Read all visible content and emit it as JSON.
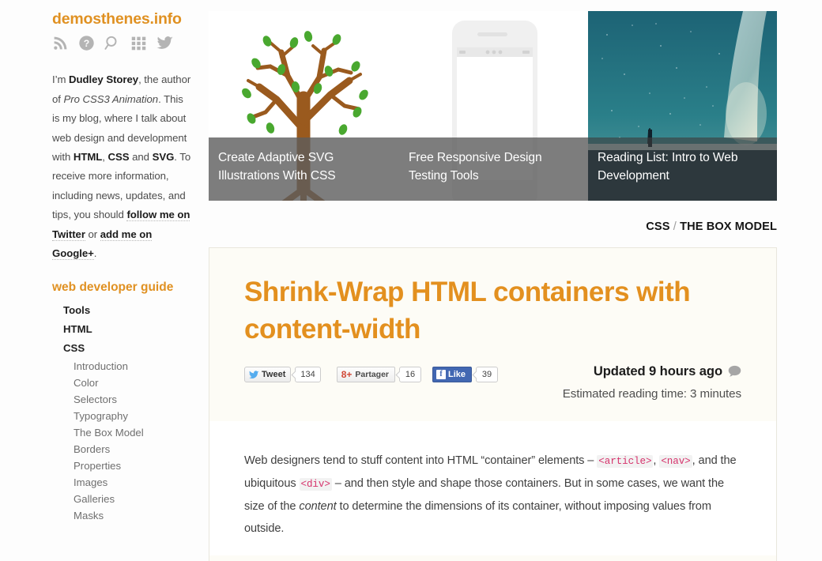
{
  "colors": {
    "accent": "#e09122",
    "title_accent": "#e3901f",
    "code_pink": "#d6336c",
    "card_bg": "#fdfcf6",
    "facebook_blue": "#4267b2",
    "gplus_red": "#d14836",
    "twitter_blue": "#55acee"
  },
  "sidebar": {
    "site_title": "demosthenes.info",
    "social_icons": [
      {
        "name": "rss-icon",
        "label": "RSS feed"
      },
      {
        "name": "help-icon",
        "label": "Help"
      },
      {
        "name": "search-icon",
        "label": "Search"
      },
      {
        "name": "grid-icon",
        "label": "All sections"
      },
      {
        "name": "twitter-icon",
        "label": "Twitter"
      }
    ],
    "bio": {
      "p1_pre": "I’m ",
      "author": "Dudley Storey",
      "p1_mid": ", the author of ",
      "book": "Pro CSS3 Animation",
      "p1_post": ". This is my blog, where I talk about web design and development with ",
      "tag_html": "HTML",
      "sep1": ", ",
      "tag_css": "CSS",
      "sep2": " and ",
      "tag_svg": "SVG",
      "p2_pre": ". To receive more information, including news, updates, and tips, you should ",
      "link_twitter": "follow me on Twitter",
      "p2_mid": " or ",
      "link_google": "add me on Google+",
      "p2_post": "."
    },
    "nav_heading": "web developer guide",
    "nav_top": [
      {
        "label": "Tools"
      },
      {
        "label": "HTML"
      },
      {
        "label": "CSS"
      }
    ],
    "nav_sub": [
      {
        "label": "Introduction"
      },
      {
        "label": "Color"
      },
      {
        "label": "Selectors"
      },
      {
        "label": "Typography"
      },
      {
        "label": "The Box Model"
      },
      {
        "label": "Borders"
      },
      {
        "label": "Properties"
      },
      {
        "label": "Images"
      },
      {
        "label": "Galleries"
      },
      {
        "label": "Masks"
      }
    ]
  },
  "featured": [
    {
      "title": "Create Adaptive SVG Illustrations With CSS",
      "image": "tree-illustration"
    },
    {
      "title": "Free Responsive Design Testing Tools",
      "image": "smartphone-illustration"
    },
    {
      "title": "Reading List: Intro to Web Development",
      "image": "milky-way-photo"
    }
  ],
  "breadcrumb": {
    "section": "CSS",
    "separator": "/",
    "page": "THE BOX MODEL"
  },
  "article": {
    "title": "Shrink-Wrap HTML containers with content-width",
    "share": {
      "twitter_label": "Tweet",
      "twitter_count": "134",
      "gplus_label": "Partager",
      "gplus_glyph": "8+",
      "gplus_count": "16",
      "facebook_label": "Like",
      "facebook_glyph": "f",
      "facebook_count": "39"
    },
    "updated": "Updated 9 hours ago",
    "comment_icon": "comment-bubble-icon",
    "reading_time": "Estimated reading time: 3 minutes",
    "body": {
      "s1": "Web designers tend to stuff content into HTML “container” elements – ",
      "code1": "<article>",
      "s2": ", ",
      "code2": "<nav>",
      "s3": ", and the ubiquitous ",
      "code3": "<div>",
      "s4": " – and then style and shape those containers. But in some cases, we want the size of the ",
      "em1": "content",
      "s5": " to determine the dimensions of its container, without imposing values from outside."
    }
  }
}
